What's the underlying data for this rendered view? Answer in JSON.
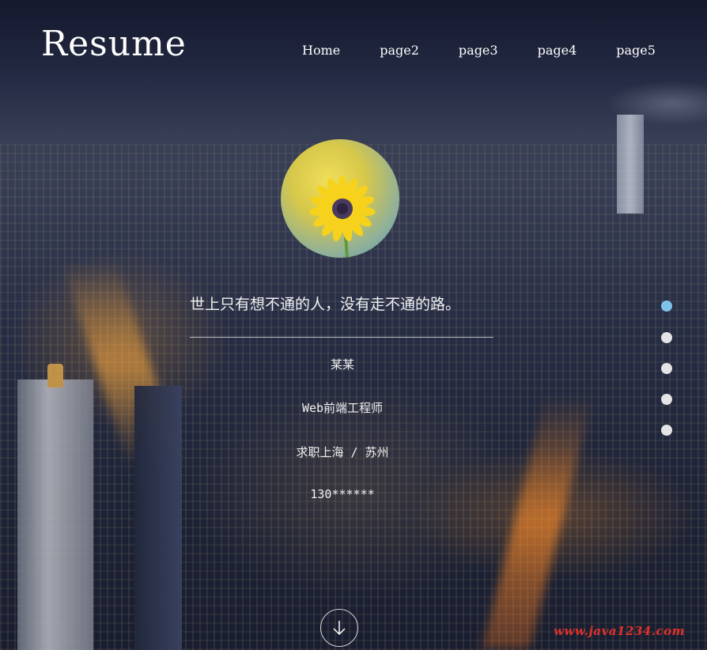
{
  "header": {
    "logo": "Resume",
    "nav": [
      "Home",
      "page2",
      "page3",
      "page4",
      "page5"
    ]
  },
  "hero": {
    "motto": "世上只有想不通的人，没有走不通的路。",
    "name": "某某",
    "job_title": "Web前端工程师",
    "location": "求职上海 / 苏州",
    "phone": "130******"
  },
  "side_nav": {
    "dot_count": 5,
    "active_index": 0,
    "active_color": "#7fc3ea",
    "dot_color": "#e4e4e6"
  },
  "icons": {
    "scroll_down": "arrow-down-icon",
    "avatar": "sunflower-avatar"
  },
  "watermark": "www.java1234.com"
}
